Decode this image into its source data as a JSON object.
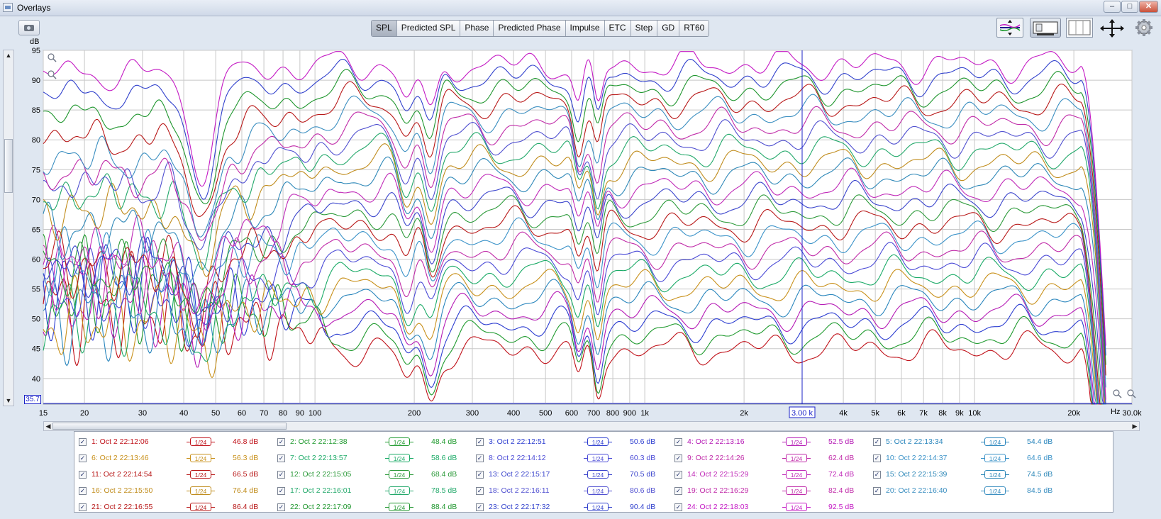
{
  "window": {
    "title": "Overlays",
    "min": "–",
    "max": "□",
    "close": "✕"
  },
  "tabs": [
    "SPL",
    "Predicted SPL",
    "Phase",
    "Predicted Phase",
    "Impulse",
    "ETC",
    "Step",
    "GD",
    "RT60"
  ],
  "active_tab": "SPL",
  "toolbar_icons": [
    "camera-icon",
    "vertical-arrows-icon",
    "controls-panel-icon",
    "graph-panel-icon",
    "move-arrows-icon",
    "gear-icon"
  ],
  "chart_data": {
    "type": "line",
    "ylabel": "dB",
    "xunit": "Hz",
    "xscale": "log",
    "xlim": [
      15,
      30000
    ],
    "ylim": [
      35.7,
      95
    ],
    "yticks": [
      40,
      45,
      50,
      55,
      60,
      65,
      70,
      75,
      80,
      85,
      90,
      95
    ],
    "xticks": [
      "15",
      "20",
      "30",
      "40",
      "50",
      "60",
      "70",
      "80",
      "90",
      "100",
      "200",
      "300",
      "400",
      "500",
      "600",
      "700",
      "800",
      "900",
      "1k",
      "2k",
      "3.00 k",
      "4k",
      "5k",
      "6k",
      "7k",
      "8k",
      "9k",
      "10k",
      "20k",
      "30.0k"
    ],
    "xtick_values": [
      15,
      20,
      30,
      40,
      50,
      60,
      70,
      80,
      90,
      100,
      200,
      300,
      400,
      500,
      600,
      700,
      800,
      900,
      1000,
      2000,
      3000,
      4000,
      5000,
      6000,
      7000,
      8000,
      9000,
      10000,
      20000,
      30000
    ],
    "cursor_x": 3000,
    "cursor_x_label": "3.00 k",
    "cursor_y": 35.7,
    "cursor_y_label": "35.7",
    "grid": true,
    "series": [
      {
        "name": "1: Oct 2 22:12:06",
        "offset": "46.8 dB",
        "color": "#c0121a",
        "smoothing": "1/24"
      },
      {
        "name": "2: Oct 2 22:12:38",
        "offset": "48.4 dB",
        "color": "#1f9a2e",
        "smoothing": "1/24"
      },
      {
        "name": "3: Oct 2 22:12:51",
        "offset": "50.6 dB",
        "color": "#2b3cd0",
        "smoothing": "1/24"
      },
      {
        "name": "4: Oct 2 22:13:16",
        "offset": "52.5 dB",
        "color": "#b51ab5",
        "smoothing": "1/24"
      },
      {
        "name": "5: Oct 2 22:13:34",
        "offset": "54.4 dB",
        "color": "#2a86bd",
        "smoothing": "1/24"
      },
      {
        "name": "6: Oct 2 22:13:46",
        "offset": "56.3 dB",
        "color": "#c8901a",
        "smoothing": "1/24"
      },
      {
        "name": "7: Oct 2 22:13:57",
        "offset": "58.6 dB",
        "color": "#1aaa66",
        "smoothing": "1/24"
      },
      {
        "name": "8: Oct 2 22:14:12",
        "offset": "60.3 dB",
        "color": "#4a4ad6",
        "smoothing": "1/24"
      },
      {
        "name": "9: Oct 2 22:14:26",
        "offset": "62.4 dB",
        "color": "#c02aa8",
        "smoothing": "1/24"
      },
      {
        "name": "10: Oct 2 22:14:37",
        "offset": "64.6 dB",
        "color": "#3a92c8",
        "smoothing": "1/24"
      },
      {
        "name": "11: Oct 2 22:14:54",
        "offset": "66.5 dB",
        "color": "#b81818",
        "smoothing": "1/24"
      },
      {
        "name": "12: Oct 2 22:15:05",
        "offset": "68.4 dB",
        "color": "#2c9a3a",
        "smoothing": "1/24"
      },
      {
        "name": "13: Oct 2 22:15:17",
        "offset": "70.5 dB",
        "color": "#3a44cc",
        "smoothing": "1/24"
      },
      {
        "name": "14: Oct 2 22:15:29",
        "offset": "72.4 dB",
        "color": "#c02ab8",
        "smoothing": "1/24"
      },
      {
        "name": "15: Oct 2 22:15:39",
        "offset": "74.5 dB",
        "color": "#2e88b8",
        "smoothing": "1/24"
      },
      {
        "name": "16: Oct 2 22:15:50",
        "offset": "76.4 dB",
        "color": "#c08c1c",
        "smoothing": "1/24"
      },
      {
        "name": "17: Oct 2 22:16:01",
        "offset": "78.5 dB",
        "color": "#22a86a",
        "smoothing": "1/24"
      },
      {
        "name": "18: Oct 2 22:16:11",
        "offset": "80.6 dB",
        "color": "#5050d0",
        "smoothing": "1/24"
      },
      {
        "name": "19: Oct 2 22:16:29",
        "offset": "82.4 dB",
        "color": "#c02aa8",
        "smoothing": "1/24"
      },
      {
        "name": "20: Oct 2 22:16:40",
        "offset": "84.5 dB",
        "color": "#3a8ec0",
        "smoothing": "1/24"
      },
      {
        "name": "21: Oct 2 22:16:55",
        "offset": "86.4 dB",
        "color": "#b81818",
        "smoothing": "1/24"
      },
      {
        "name": "22: Oct 2 22:17:09",
        "offset": "88.4 dB",
        "color": "#1f962e",
        "smoothing": "1/24"
      },
      {
        "name": "23: Oct 2 22:17:32",
        "offset": "90.4 dB",
        "color": "#3040cc",
        "smoothing": "1/24"
      },
      {
        "name": "24: Oct 2 22:18:03",
        "offset": "92.5 dB",
        "color": "#c41ac4",
        "smoothing": "1/24"
      }
    ]
  }
}
